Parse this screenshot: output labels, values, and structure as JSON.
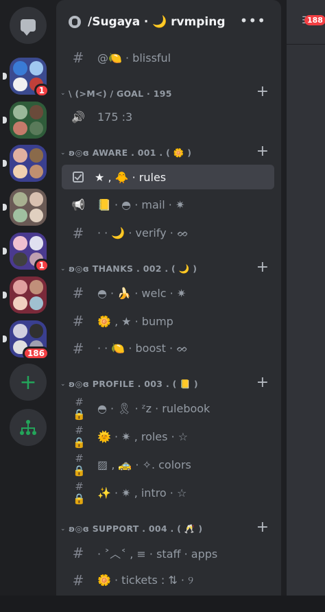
{
  "header": {
    "title": "/Sugaya ‧ 🌙 rvmping",
    "more": "•••"
  },
  "right": {
    "badge": "188"
  },
  "servers": [
    {
      "colors": [
        "#3a7bd5",
        "#a0c8f0",
        "#f0f0f0",
        "#c0403a"
      ],
      "bg": "#3b4a8f",
      "badge": "1"
    },
    {
      "colors": [
        "#9ab89a",
        "#6a4a3a",
        "#c47a6a",
        "#5a7a5a"
      ],
      "bg": "#2f5c3a",
      "badge": ""
    },
    {
      "colors": [
        "#e0b0a0",
        "#8a6a4a",
        "#f0d0b0",
        "#c09070"
      ],
      "bg": "#3a3f8f",
      "badge": ""
    },
    {
      "colors": [
        "#a8b090",
        "#d8c0b0",
        "#a0c0a0",
        "#e0d0c0"
      ],
      "bg": "#6a5a55",
      "badge": ""
    },
    {
      "colors": [
        "#f0c0d0",
        "#e0e0f0",
        "#404040",
        "#c0a0b0"
      ],
      "bg": "#4a3a8f",
      "badge": "1"
    },
    {
      "colors": [
        "#e0a0a0",
        "#c0907a",
        "#f0d0c0",
        "#a0c0d0"
      ],
      "bg": "#7a2a3a",
      "badge": ""
    },
    {
      "colors": [
        "#d0d0e0",
        "#303030",
        "#e0e0e0",
        "#a0a0b0"
      ],
      "bg": "#3a3f8f",
      "badge": "186"
    }
  ],
  "rail": {
    "add_label": "+",
    "discover_label": "⚘"
  },
  "channels": [
    {
      "type": "text",
      "name": "@🍋 · blissful"
    },
    {
      "type": "category",
      "name": "\\ (>M<) / GOAL  · 195"
    },
    {
      "type": "voice",
      "name": "175 :3"
    },
    {
      "type": "category",
      "name": "ʚ◎ɞ AWARE . 001 .  ( 🌼 )"
    },
    {
      "type": "rules",
      "name": "★ ‚ 🐥 · rules",
      "active": true
    },
    {
      "type": "announce",
      "name": "📒 · ◓ · mail · ✷"
    },
    {
      "type": "text",
      "name": "· · 🌙 · verify · ᨖ"
    },
    {
      "type": "category",
      "name": "ʚ◎ɞ THANKS . 002 .  ( 🌙 )"
    },
    {
      "type": "text",
      "name": "◓ · 🍌 · welc · ✷"
    },
    {
      "type": "text",
      "name": "🌼 ‚ ★ · bump"
    },
    {
      "type": "text",
      "name": "· · 🍋 · boost · ᨖ"
    },
    {
      "type": "category",
      "name": "ʚ◎ɞ PROFILE . 003 .  ( 📒 )"
    },
    {
      "type": "locked",
      "name": "◓ · 🎗 · ᶻz · rulebook"
    },
    {
      "type": "locked",
      "name": "🌞 · ✷ ‚ roles · ☆"
    },
    {
      "type": "locked",
      "name": "▨ ‚ 🚕 · ✧.  colors"
    },
    {
      "type": "locked",
      "name": "✨ · ✷ ‚ intro · ☆"
    },
    {
      "type": "category",
      "name": "ʚ◎ɞ SUPPORT . 004 .  ( 🥂 )"
    },
    {
      "type": "text",
      "name": "· ˃︿˂ , ≡ · staff · apps"
    },
    {
      "type": "text",
      "name": "🌼 · tickets : ⇅ · ୨"
    }
  ],
  "icons": {
    "text": "#",
    "locked": "#🔒",
    "voice": "🔊",
    "announce": "📢",
    "category_chevron": "⌄",
    "plus": "+"
  }
}
